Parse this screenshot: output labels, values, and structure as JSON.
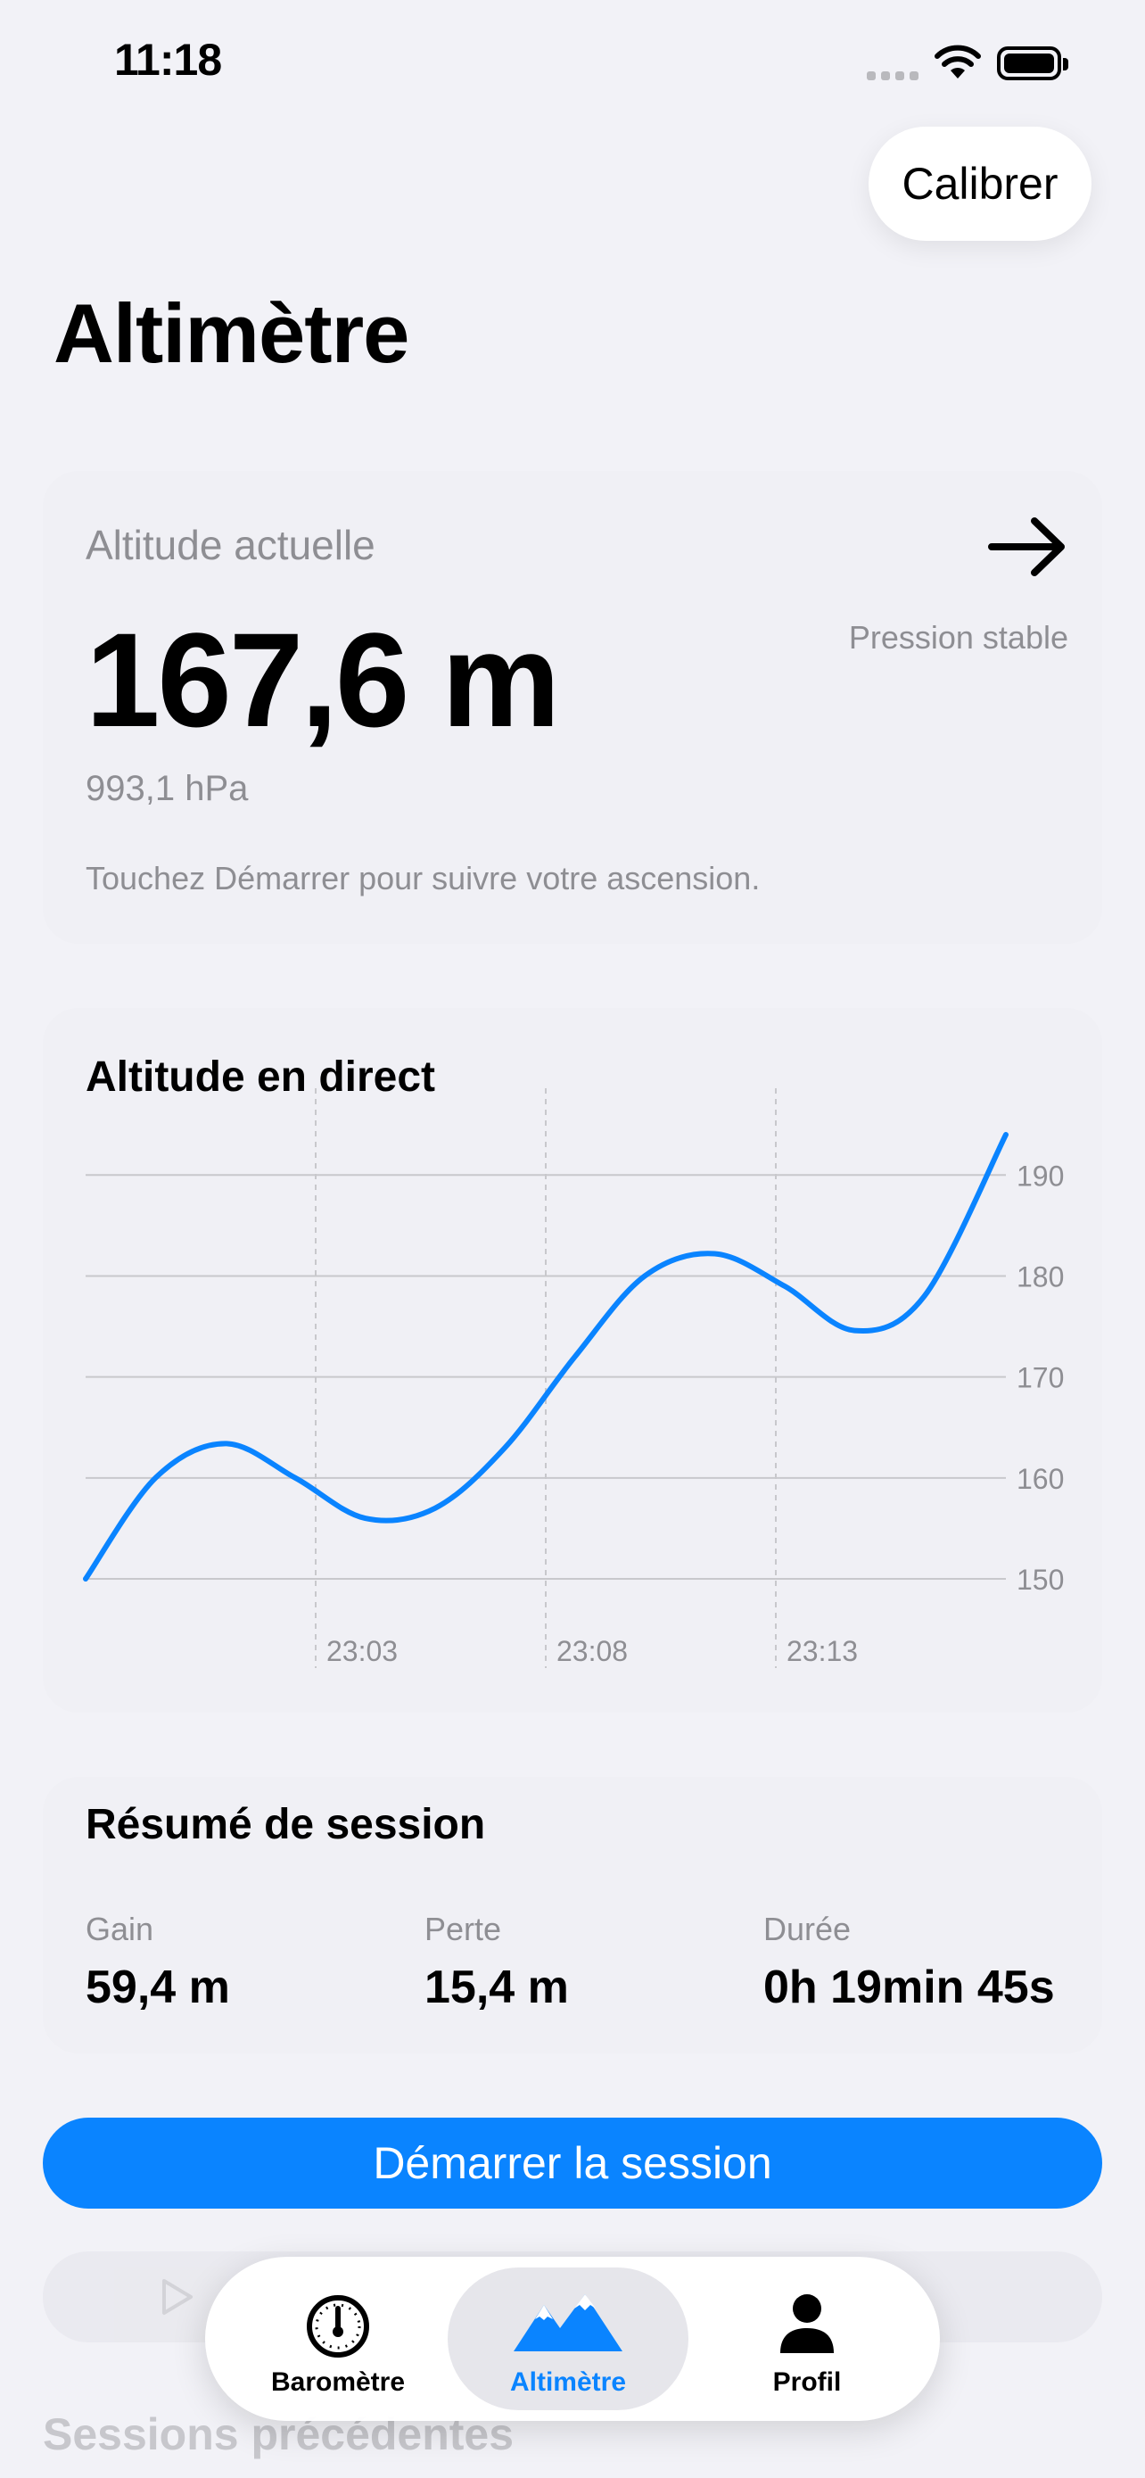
{
  "status_bar": {
    "time": "11:18"
  },
  "header": {
    "calibrate_label": "Calibrer",
    "title": "Altimètre"
  },
  "altitude_card": {
    "label": "Altitude actuelle",
    "value": "167,6 m",
    "pressure": "993,1 hPa",
    "trend": "Pression stable",
    "hint": "Touchez Démarrer pour suivre votre ascension."
  },
  "chart_card": {
    "title": "Altitude en direct"
  },
  "chart_data": {
    "type": "line",
    "title": "Altitude en direct",
    "x_tick_labels": [
      "23:03",
      "23:08",
      "23:13"
    ],
    "y_ticks": [
      150,
      160,
      170,
      180,
      190
    ],
    "ylim": [
      150,
      194
    ],
    "grid": true,
    "series": [
      {
        "color": "#0a84ff",
        "x": [
          0,
          1.5,
          3,
          4.5,
          6,
          7.5,
          9,
          10.5,
          12,
          13.5,
          15,
          16.5,
          18,
          19.75
        ],
        "values": [
          150.0,
          160.0,
          163.4,
          160.0,
          156.0,
          157.0,
          163.0,
          172.0,
          180.0,
          182.2,
          179.0,
          174.6,
          178.0,
          194.0
        ]
      }
    ]
  },
  "summary": {
    "title": "Résumé de session",
    "items": [
      {
        "label": "Gain",
        "value": "59,4 m"
      },
      {
        "label": "Perte",
        "value": "15,4 m"
      },
      {
        "label": "Durée",
        "value": "0h 19min 45s"
      }
    ]
  },
  "actions": {
    "start_label": "Démarrer la session"
  },
  "previous_sessions": {
    "title": "Sessions précédentes"
  },
  "tab_bar": {
    "tabs": [
      {
        "label": "Baromètre",
        "icon": "gauge-icon"
      },
      {
        "label": "Altimètre",
        "icon": "mountains-icon",
        "selected": true
      },
      {
        "label": "Profil",
        "icon": "person-icon"
      }
    ],
    "accent": "#0a84ff"
  }
}
